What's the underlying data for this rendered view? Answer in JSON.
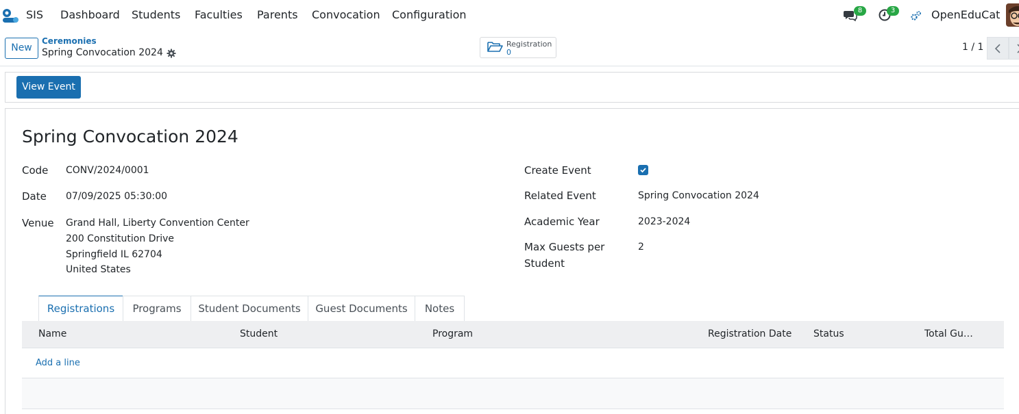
{
  "navbar": {
    "brand": "SIS",
    "menus": [
      "Dashboard",
      "Students",
      "Faculties",
      "Parents",
      "Convocation",
      "Configuration"
    ],
    "messages_count": "8",
    "activities_count": "3",
    "user_name": "OpenEduCat"
  },
  "control_panel": {
    "new_label": "New",
    "breadcrumb_parent": "Ceremonies",
    "breadcrumb_current": "Spring Convocation 2024",
    "smart_button": {
      "label": "Registration",
      "value": "0",
      "icon": "folder-open-icon"
    },
    "pager": "1 / 1"
  },
  "statusbar": {
    "view_event_label": "View Event"
  },
  "form": {
    "title": "Spring Convocation 2024",
    "left_fields": {
      "code": {
        "label": "Code",
        "value": "CONV/2024/0001"
      },
      "date": {
        "label": "Date",
        "value": "07/09/2025 05:30:00"
      },
      "venue": {
        "label": "Venue",
        "line1": "Grand Hall, Liberty Convention Center",
        "line2": "200 Constitution Drive",
        "line3": "Springfield IL 62704",
        "line4": "United States"
      }
    },
    "right_fields": {
      "create_event": {
        "label": "Create Event",
        "checked": true
      },
      "related_event": {
        "label": "Related Event",
        "value": "Spring Convocation 2024"
      },
      "academic_year": {
        "label": "Academic Year",
        "value": "2023-2024"
      },
      "max_guests": {
        "label_line1": "Max Guests per",
        "label_line2": "Student",
        "value": "2"
      }
    }
  },
  "tabs": [
    "Registrations",
    "Programs",
    "Student Documents",
    "Guest Documents",
    "Notes"
  ],
  "table": {
    "columns": [
      "Name",
      "Student",
      "Program",
      "Registration Date",
      "Status",
      "Total Gu…"
    ],
    "add_line_label": "Add a line"
  },
  "colors": {
    "accent": "#1a6fb0",
    "badge": "#28a745"
  }
}
